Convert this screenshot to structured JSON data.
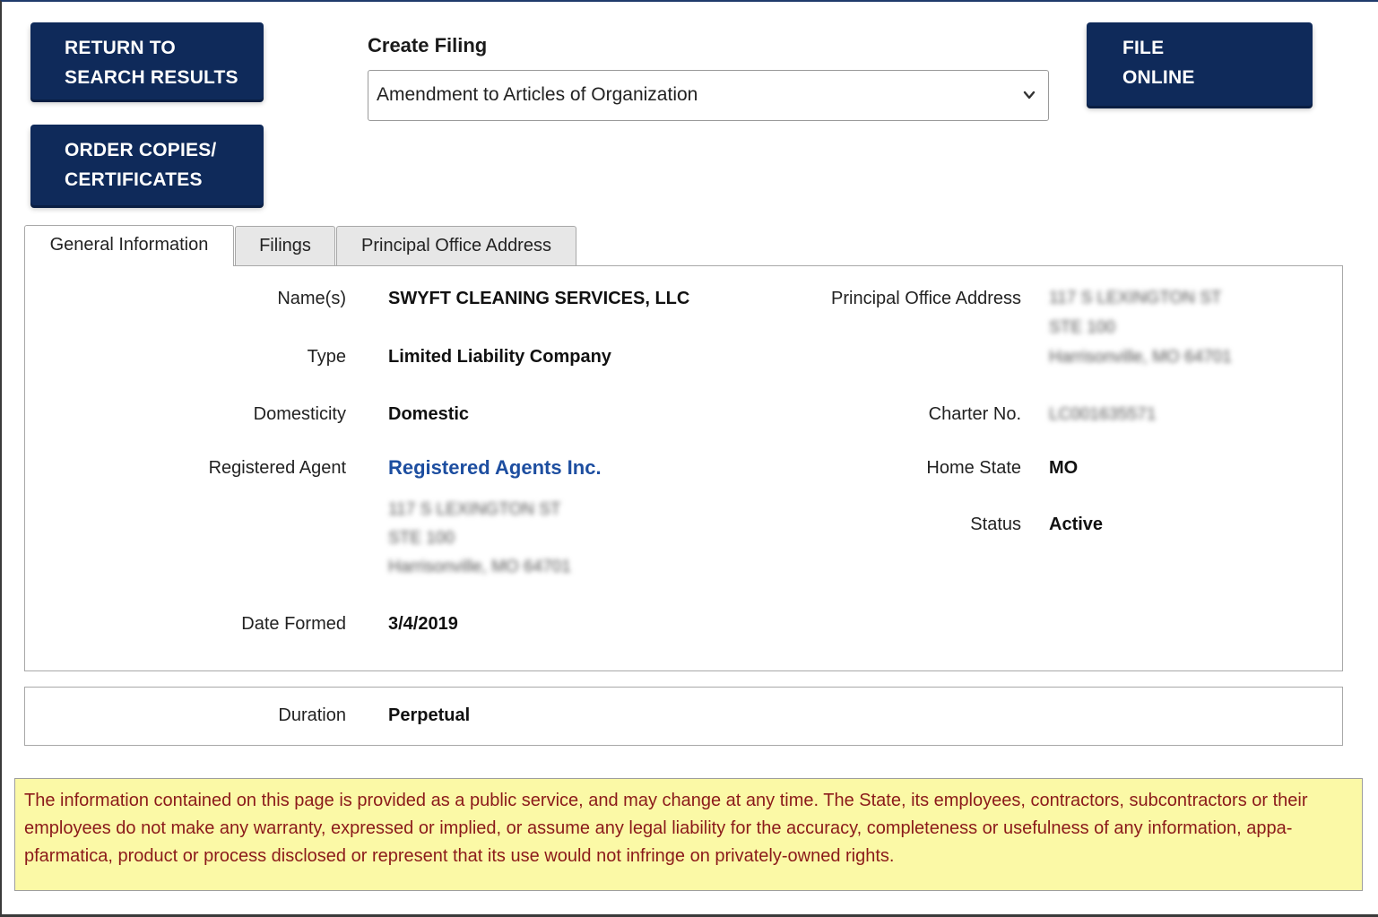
{
  "actions": {
    "return_label": "RETURN TO\nSEARCH RESULTS",
    "order_label": "ORDER COPIES/\nCERTIFICATES",
    "file_label": "FILE\nONLINE"
  },
  "create_filing": {
    "label": "Create Filing",
    "selected": "Amendment to Articles of Organization"
  },
  "tabs": [
    {
      "label": "General Information",
      "active": true
    },
    {
      "label": "Filings",
      "active": false
    },
    {
      "label": "Principal Office Address",
      "active": false
    }
  ],
  "general": {
    "names_label": "Name(s)",
    "names_value": "SWYFT CLEANING SERVICES, LLC",
    "type_label": "Type",
    "type_value": "Limited Liability Company",
    "domesticity_label": "Domesticity",
    "domesticity_value": "Domestic",
    "agent_label": "Registered Agent",
    "agent_value": "Registered Agents Inc.",
    "agent_address": [
      "117 S LEXINGTON ST",
      "STE 100",
      "Harrisonville, MO 64701"
    ],
    "date_label": "Date Formed",
    "date_value": "3/4/2019",
    "principal_label": "Principal Office Address",
    "principal_address": [
      "117 S LEXINGTON ST",
      "STE 100",
      "Harrisonville, MO 64701"
    ],
    "charter_label": "Charter No.",
    "charter_value": "LC001635571",
    "home_state_label": "Home State",
    "home_state_value": "MO",
    "status_label": "Status",
    "status_value": "Active"
  },
  "duration": {
    "label": "Duration",
    "value": "Perpetual"
  },
  "disclaimer": "The information contained on this page is provided as a public service, and may change at any time. The State, its employees, contractors, subcontractors or their employees do not make any warranty, expressed or implied, or assume any legal liability for the accuracy, completeness or usefulness of any information, appa-pfarmatiса, product or process disclosed or represent that its use would not infringe on privately-owned rights.",
  "colors": {
    "button_bg": "#0f2a5a",
    "link": "#1d4ea0",
    "disclaimer_bg": "#fbf9a6",
    "disclaimer_text": "#8b1a1a"
  }
}
